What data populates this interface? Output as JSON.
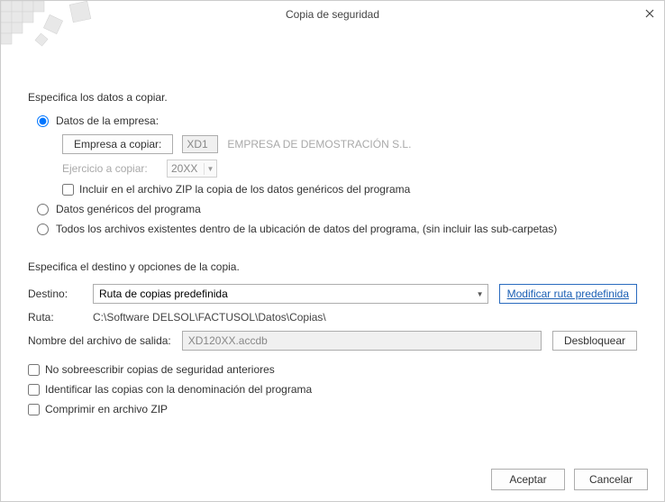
{
  "window": {
    "title": "Copia de seguridad"
  },
  "section1": {
    "heading": "Especifica los datos a copiar.",
    "radio_empresa": "Datos de la empresa:",
    "empresa_btn": "Empresa a copiar:",
    "empresa_code": "XD1",
    "empresa_name": "EMPRESA DE DEMOSTRACIÓN S.L.",
    "ejercicio_label": "Ejercicio a copiar:",
    "ejercicio_value": "20XX",
    "chk_zip_generic": "Incluir en el archivo ZIP la copia de los datos genéricos del programa",
    "radio_genericos": "Datos genéricos del programa",
    "radio_todos": "Todos los archivos existentes dentro de la ubicación de datos del programa, (sin incluir las sub-carpetas)"
  },
  "section2": {
    "heading": "Especifica el destino y opciones de la copia.",
    "destino_label": "Destino:",
    "destino_value": "Ruta de copias predefinida",
    "modificar_btn": "Modificar ruta predefinida",
    "ruta_label": "Ruta:",
    "ruta_value": "C:\\Software DELSOL\\FACTUSOL\\Datos\\Copias\\",
    "output_label": "Nombre del archivo de salida:",
    "output_value": "XD120XX.accdb",
    "desbloquear_btn": "Desbloquear",
    "chk_no_overwrite": "No sobreescribir copias de seguridad anteriores",
    "chk_identify": "Identificar las copias con la denominación del programa",
    "chk_compress": "Comprimir en archivo ZIP"
  },
  "footer": {
    "accept": "Aceptar",
    "cancel": "Cancelar"
  }
}
